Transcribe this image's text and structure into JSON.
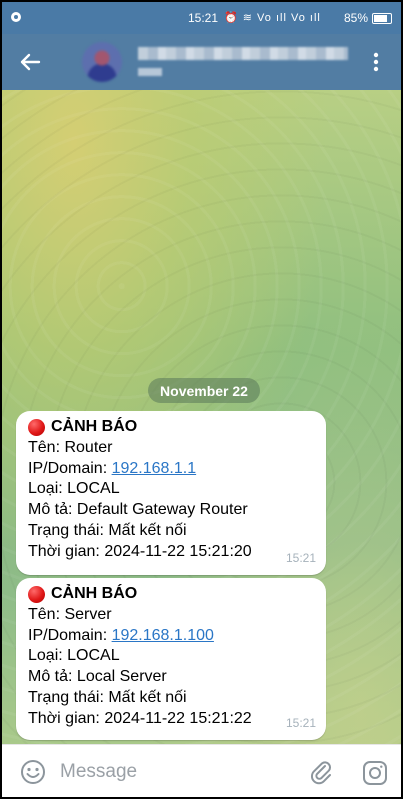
{
  "status_bar": {
    "time": "15:21",
    "network_label": "Vo",
    "network_label_2": "Vo",
    "network_icons": "⏰ ⌔ Vo ıll Vo ıll",
    "battery": "85%"
  },
  "header": {
    "icons": {
      "back": "arrow-left-icon",
      "menu": "more-vertical-icon"
    }
  },
  "chat": {
    "date": "November 22",
    "messages": [
      {
        "title": "CẢNH BÁO",
        "name_label": "Tên:",
        "name_value": "Router",
        "ip_label": "IP/Domain:",
        "ip_value": "192.168.1.1",
        "type_label": "Loại:",
        "type_value": "LOCAL",
        "desc_label": "Mô tả:",
        "desc_value": "Default Gateway Router",
        "state_label": "Trạng thái:",
        "state_value": "Mất kết nối",
        "time_label": "Thời gian:",
        "time_value": "2024-11-22 15:21:20",
        "sent_time": "15:21"
      },
      {
        "title": "CẢNH BÁO",
        "name_label": "Tên:",
        "name_value": "Server",
        "ip_label": "IP/Domain:",
        "ip_value": "192.168.1.100",
        "type_label": "Loại:",
        "type_value": "LOCAL",
        "desc_label": "Mô tả:",
        "desc_value": "Local Server",
        "state_label": "Trạng thái:",
        "state_value": "Mất kết nối",
        "time_label": "Thời gian:",
        "time_value": "2024-11-22 15:21:22",
        "sent_time": "15:21"
      }
    ]
  },
  "input": {
    "placeholder": "Message",
    "icons": {
      "emoji": "smiley-icon",
      "attach": "paperclip-icon",
      "camera": "camera-icon"
    }
  },
  "colors": {
    "header": "#527da3",
    "status_bar": "#4a7aa6",
    "link": "#2a76c6",
    "alert_dot": "#e01818"
  }
}
